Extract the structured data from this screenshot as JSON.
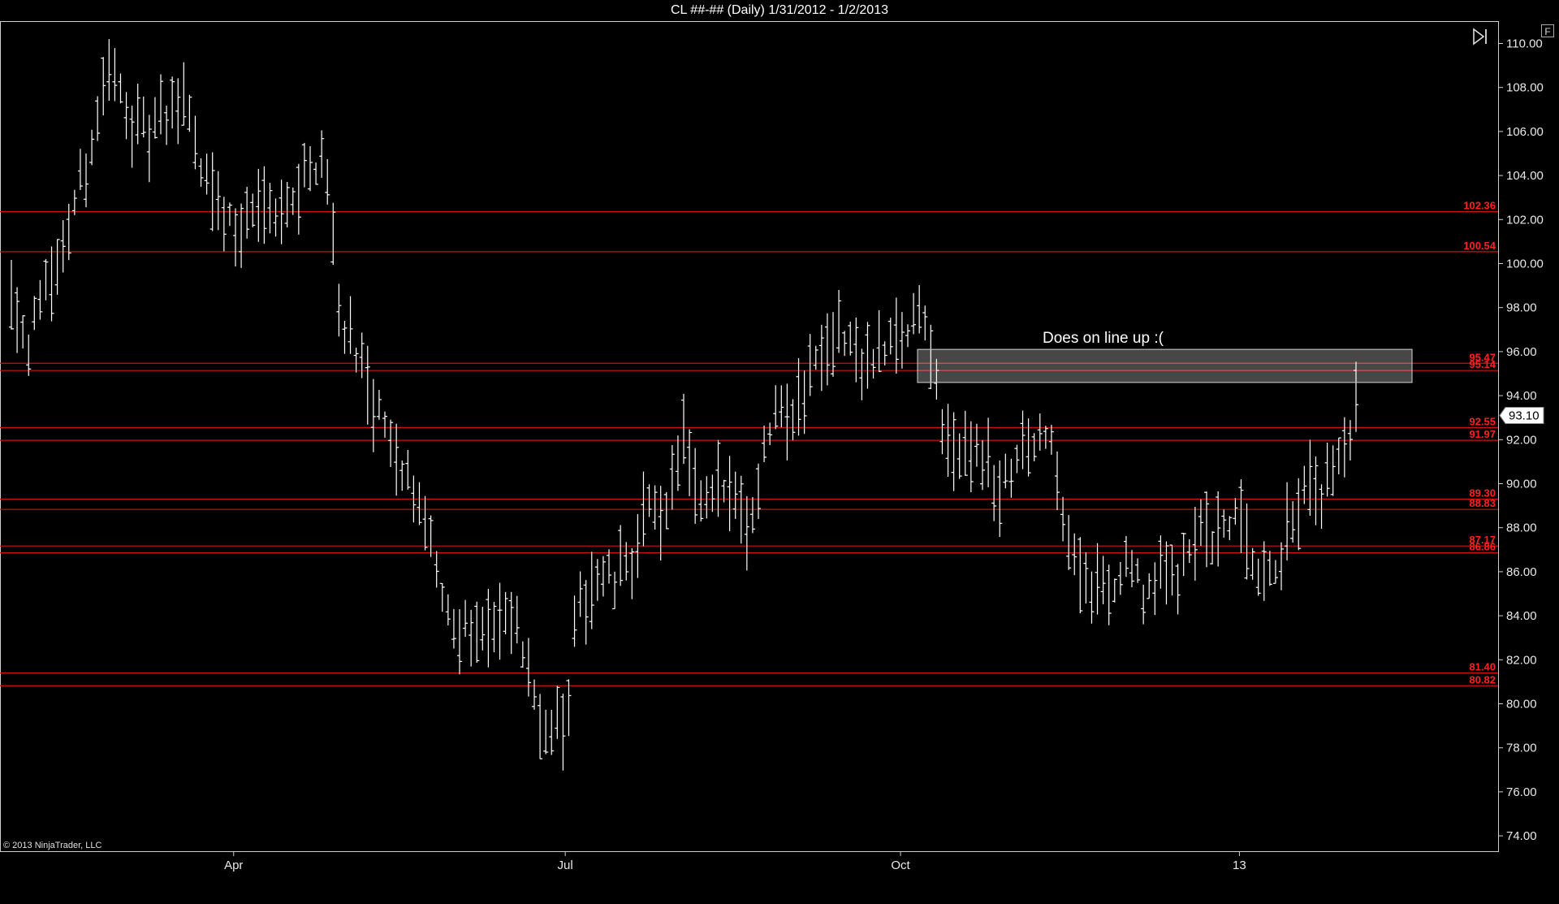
{
  "window": {
    "title": "CL ##-## (Daily)  1/31/2012 - 1/2/2013",
    "f_label": "F"
  },
  "copyright": "© 2013 NinjaTrader, LLC",
  "annotation": {
    "text": "Does on line up :(",
    "box_low": 94.6,
    "box_high": 96.1
  },
  "colors": {
    "background": "#000000",
    "bars": "#ffffff",
    "levels": "#d01010",
    "level_labels": "#ff2020"
  },
  "chart_data": {
    "type": "bar",
    "title": "CL ##-## (Daily)  1/31/2012 - 1/2/2013",
    "ylim": [
      73.6,
      111.0
    ],
    "y_ticks": [
      110,
      108,
      106,
      104,
      102,
      100,
      98,
      96,
      94,
      92,
      90,
      88,
      86,
      84,
      82,
      80,
      78,
      76,
      74
    ],
    "y_tick_labels": [
      "110.00",
      "108.00",
      "106.00",
      "104.00",
      "102.00",
      "100.00",
      "98.00",
      "96.00",
      "94.00",
      "92.00",
      "90.00",
      "88.00",
      "86.00",
      "84.00",
      "82.00",
      "80.00",
      "78.00",
      "76.00",
      "74.00"
    ],
    "x_tick_labels": [
      "Apr",
      "Jul",
      "Oct",
      "13"
    ],
    "last_price": "93.10",
    "levels": [
      {
        "value": 102.36,
        "label": "102.36"
      },
      {
        "value": 100.54,
        "label": "100.54"
      },
      {
        "value": 95.47,
        "label": "95.47"
      },
      {
        "value": 95.14,
        "label": "95.14"
      },
      {
        "value": 92.55,
        "label": "92.55"
      },
      {
        "value": 91.97,
        "label": "91.97"
      },
      {
        "value": 89.3,
        "label": "89.30"
      },
      {
        "value": 88.83,
        "label": "88.83"
      },
      {
        "value": 87.17,
        "label": "87.17"
      },
      {
        "value": 86.86,
        "label": "86.86"
      },
      {
        "value": 81.4,
        "label": "81.40"
      },
      {
        "value": 80.82,
        "label": "80.82"
      }
    ],
    "waypoints": [
      [
        0,
        98.5
      ],
      [
        5,
        96.5
      ],
      [
        12,
        99.5
      ],
      [
        17,
        102.5
      ],
      [
        22,
        105.5
      ],
      [
        27,
        109.0
      ],
      [
        32,
        107.0
      ],
      [
        37,
        106.0
      ],
      [
        43,
        106.5
      ],
      [
        48,
        107.5
      ],
      [
        53,
        104.0
      ],
      [
        58,
        102.0
      ],
      [
        63,
        101.5
      ],
      [
        68,
        103.0
      ],
      [
        74,
        102.5
      ],
      [
        80,
        104.0
      ],
      [
        85,
        105.0
      ],
      [
        88,
        102.5
      ],
      [
        90,
        98.0
      ],
      [
        94,
        96.5
      ],
      [
        98,
        94.5
      ],
      [
        103,
        92.0
      ],
      [
        108,
        90.5
      ],
      [
        112,
        89.0
      ],
      [
        116,
        86.5
      ],
      [
        122,
        83.0
      ],
      [
        128,
        84.0
      ],
      [
        133,
        83.0
      ],
      [
        138,
        84.0
      ],
      [
        142,
        81.5
      ],
      [
        146,
        79.0
      ],
      [
        150,
        79.5
      ],
      [
        152,
        78.0
      ],
      [
        155,
        84.0
      ],
      [
        160,
        86.0
      ],
      [
        165,
        85.5
      ],
      [
        170,
        86.5
      ],
      [
        175,
        88.5
      ],
      [
        180,
        89.0
      ],
      [
        185,
        92.0
      ],
      [
        188,
        88.5
      ],
      [
        192,
        89.5
      ],
      [
        198,
        90.0
      ],
      [
        202,
        88.0
      ],
      [
        206,
        91.0
      ],
      [
        210,
        94.0
      ],
      [
        215,
        93.5
      ],
      [
        220,
        95.5
      ],
      [
        225,
        97.0
      ],
      [
        230,
        96.5
      ],
      [
        235,
        95.5
      ],
      [
        240,
        96.0
      ],
      [
        245,
        96.5
      ],
      [
        250,
        98.0
      ],
      [
        252,
        96.0
      ],
      [
        255,
        93.0
      ],
      [
        258,
        91.5
      ],
      [
        262,
        92.0
      ],
      [
        266,
        91.5
      ],
      [
        270,
        89.5
      ],
      [
        274,
        90.5
      ],
      [
        278,
        91.5
      ],
      [
        282,
        92.0
      ],
      [
        285,
        92.5
      ],
      [
        288,
        88.5
      ],
      [
        292,
        86.5
      ],
      [
        296,
        85.5
      ],
      [
        302,
        85.0
      ],
      [
        306,
        86.5
      ],
      [
        310,
        85.0
      ],
      [
        315,
        85.5
      ],
      [
        320,
        86.0
      ],
      [
        325,
        88.0
      ],
      [
        330,
        87.0
      ],
      [
        335,
        88.5
      ],
      [
        340,
        86.5
      ],
      [
        344,
        85.5
      ],
      [
        348,
        86.5
      ],
      [
        352,
        88.0
      ],
      [
        356,
        90.0
      ],
      [
        360,
        89.5
      ],
      [
        364,
        91.0
      ],
      [
        367,
        91.5
      ],
      [
        369,
        93.1
      ]
    ],
    "bar_count": 235
  }
}
